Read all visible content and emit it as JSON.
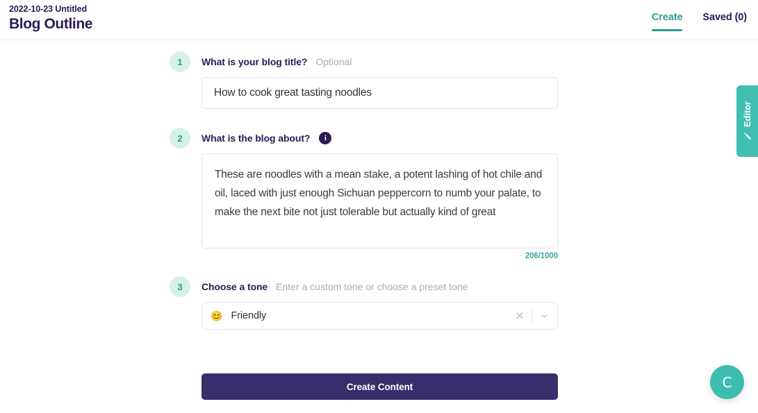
{
  "header": {
    "doc_date": "2022-10-23 Untitled",
    "doc_title": "Blog Outline",
    "tabs": [
      {
        "label": "Create",
        "active": true
      },
      {
        "label": "Saved (0)",
        "active": false
      }
    ]
  },
  "steps": {
    "one": {
      "number": "1",
      "label": "What is your blog title?",
      "hint": "Optional",
      "value": "How to cook great tasting noodles"
    },
    "two": {
      "number": "2",
      "label": "What is the blog about?",
      "info_icon": "i",
      "value": "These are noodles with a mean stake, a potent lashing of hot chile and oil, laced with just enough Sichuan peppercorn to numb your palate, to make the next bite not just tolerable but actually kind of great",
      "counter": "206/1000"
    },
    "three": {
      "number": "3",
      "label": "Choose a tone",
      "hint": "Enter a custom tone or choose a preset tone",
      "selected_emoji": "😊",
      "selected_value": "Friendly",
      "clear_glyph": "✕"
    }
  },
  "submit": {
    "label": "Create Content"
  },
  "editor_tab": {
    "label": "Editor"
  },
  "fab": {
    "label": "C"
  },
  "colors": {
    "teal": "#2a9d8f",
    "teal_tab": "#41bfb2",
    "navy": "#2b1a55",
    "purple_button": "#3a2d6b",
    "mint_circle": "#d6f1e8",
    "muted_text": "#a7acb6",
    "border": "#e2e4e8"
  }
}
